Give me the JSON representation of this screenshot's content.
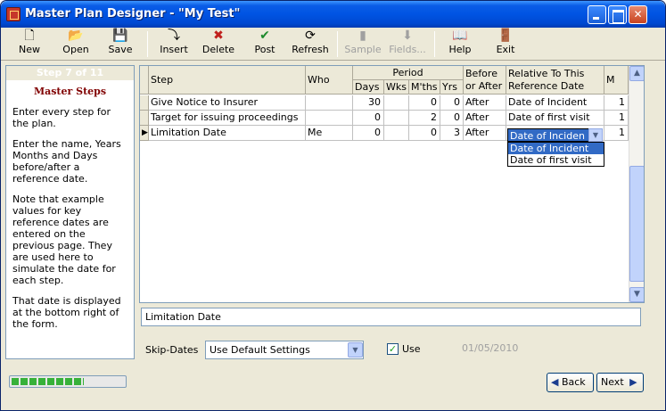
{
  "window": {
    "title": "Master Plan Designer - \"My Test\""
  },
  "toolbar": {
    "items": [
      {
        "label": "New",
        "icon": "new-document-icon",
        "glyph": "🗋",
        "enabled": true
      },
      {
        "label": "Open",
        "icon": "open-folder-icon",
        "glyph": "📂",
        "enabled": true
      },
      {
        "label": "Save",
        "icon": "save-disk-icon",
        "glyph": "💾",
        "enabled": true
      },
      {
        "label": "Insert",
        "icon": "insert-icon",
        "glyph": "⤵",
        "enabled": true
      },
      {
        "label": "Delete",
        "icon": "delete-x-icon",
        "glyph": "✖",
        "enabled": true
      },
      {
        "label": "Post",
        "icon": "post-checkmark-icon",
        "glyph": "✔",
        "enabled": true
      },
      {
        "label": "Refresh",
        "icon": "refresh-icon",
        "glyph": "⟳",
        "enabled": true
      },
      {
        "label": "Sample",
        "icon": "sample-icon",
        "glyph": "▮",
        "enabled": false
      },
      {
        "label": "Fields...",
        "icon": "fields-icon",
        "glyph": "⬇",
        "enabled": false
      },
      {
        "label": "Help",
        "icon": "help-book-icon",
        "glyph": "📖",
        "enabled": true
      },
      {
        "label": "Exit",
        "icon": "exit-door-icon",
        "glyph": "🚪",
        "enabled": true
      }
    ],
    "colors": {
      "delete": "#c0201c",
      "post": "#1e8a2d"
    }
  },
  "sidebar": {
    "step_counter": "Step 7 of 11",
    "title": "Master Steps",
    "paragraphs": [
      "Enter every step for the plan.",
      "Enter the name, Years Months and Days before/after a reference date.",
      "Note that example values for key reference dates are entered on the previous page. They are used here to simulate the date for each step.",
      "That date is displayed at the bottom right of the form."
    ]
  },
  "grid": {
    "headers": {
      "step": "Step",
      "who": "Who",
      "period": "Period",
      "days": "Days",
      "wks": "Wks",
      "mths": "M'ths",
      "yrs": "Yrs",
      "before_after": "Before or After",
      "relative": "Relative To This Reference Date",
      "m": "M"
    },
    "rows": [
      {
        "step": "Give Notice to Insurer",
        "who": "",
        "days": "30",
        "wks": "",
        "mths": "0",
        "yrs": "0",
        "before_after": "After",
        "relative": "Date of Incident",
        "m": "1"
      },
      {
        "step": "Target for issuing proceedings",
        "who": "",
        "days": "0",
        "wks": "",
        "mths": "2",
        "yrs": "0",
        "before_after": "After",
        "relative": "Date of first visit",
        "m": "1"
      },
      {
        "step": "Limitation Date",
        "who": "Me",
        "days": "0",
        "wks": "",
        "mths": "0",
        "yrs": "3",
        "before_after": "After",
        "relative": "Date of Inciden",
        "m": "1"
      }
    ],
    "dropdown": {
      "current": "Date of Inciden",
      "options": [
        "Date of Incident",
        "Date of first visit"
      ]
    }
  },
  "step_name_field": {
    "value": "Limitation Date"
  },
  "skip_dates": {
    "label": "Skip-Dates",
    "value": "Use Default Settings",
    "use_label": "Use",
    "use_checked": true,
    "date": "01/05/2010"
  },
  "progress": {
    "fraction": 0.64
  },
  "nav": {
    "back": "Back",
    "next": "Next"
  }
}
